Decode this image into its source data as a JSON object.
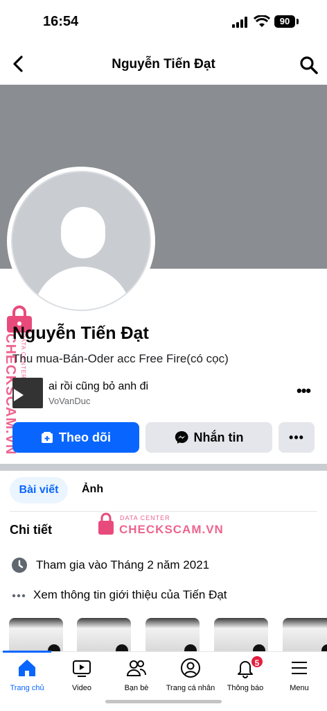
{
  "status_bar": {
    "time": "16:54",
    "battery": "90"
  },
  "top_nav": {
    "title": "Nguyễn Tiến Đạt"
  },
  "profile": {
    "name": "Nguyễn Tiến Đạt",
    "bio": "Thu mua-Bán-Oder acc Free Fire(có cọc)"
  },
  "music": {
    "title": "ai rồi cũng bỏ anh đi",
    "artist": "VoVanDuc"
  },
  "actions": {
    "follow_label": "Theo dõi",
    "message_label": "Nhắn tin",
    "more_label": "•••"
  },
  "tabs": {
    "posts": "Bài viết",
    "photos": "Ảnh"
  },
  "details": {
    "title": "Chi tiết",
    "joined": "Tham gia vào Tháng 2 năm 2021",
    "about": "Xem thông tin giới thiệu của Tiến Đạt"
  },
  "watermark": {
    "top": "DATA CENTER",
    "main": "CHECKSCAM.VN"
  },
  "bottom_nav": {
    "items": [
      {
        "label": "Trang chủ"
      },
      {
        "label": "Video"
      },
      {
        "label": "Bạn bè"
      },
      {
        "label": "Trang cá nhân"
      },
      {
        "label": "Thông báo"
      },
      {
        "label": "Menu"
      }
    ],
    "notification_badge": "5"
  },
  "colors": {
    "accent": "#0866ff",
    "cover": "#8a8d91",
    "watermark": "#e94a7c",
    "badge": "#e41e3f"
  },
  "icons": [
    "back-icon",
    "search-icon",
    "clock-icon",
    "dots-icon",
    "home-icon",
    "video-icon",
    "friends-icon",
    "profile-icon",
    "bell-icon",
    "menu-icon",
    "messenger-icon",
    "follow-icon"
  ]
}
